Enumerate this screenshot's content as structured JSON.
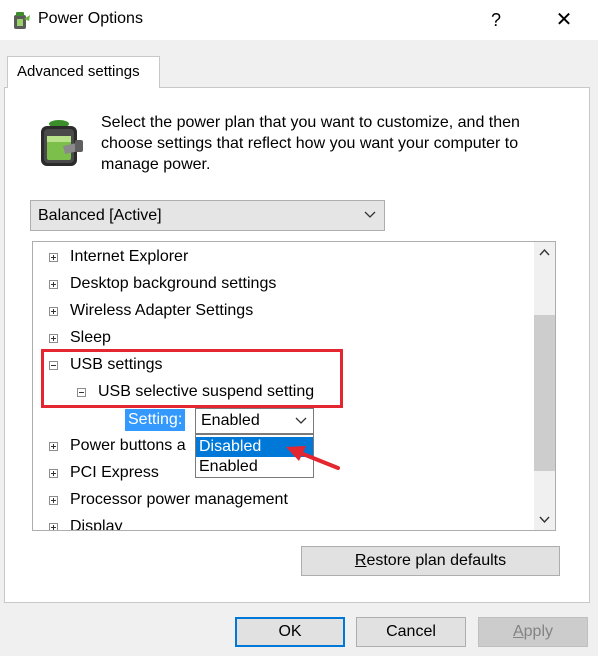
{
  "window": {
    "title": "Power Options",
    "help_label": "?",
    "close_label": "✕"
  },
  "tab": {
    "label": "Advanced settings"
  },
  "description": "Select the power plan that you want to customize, and then choose settings that reflect how you want your computer to manage power.",
  "plan_select": {
    "value": "Balanced [Active]"
  },
  "tree": {
    "items": [
      {
        "label": "Internet Explorer",
        "expanded": false
      },
      {
        "label": "Desktop background settings",
        "expanded": false
      },
      {
        "label": "Wireless Adapter Settings",
        "expanded": false
      },
      {
        "label": "Sleep",
        "expanded": false
      },
      {
        "label": "USB settings",
        "expanded": true
      },
      {
        "label": "USB selective suspend setting",
        "expanded": true
      },
      {
        "label": "Power buttons a",
        "expanded": false
      },
      {
        "label": "PCI Express",
        "expanded": false
      },
      {
        "label": "Processor power management",
        "expanded": false
      },
      {
        "label": "Display",
        "expanded": false
      }
    ]
  },
  "setting": {
    "label": "Setting:",
    "value": "Enabled",
    "options": [
      "Disabled",
      "Enabled"
    ],
    "highlighted_option": "Disabled"
  },
  "buttons": {
    "restore_prefix": "R",
    "restore_rest": "estore plan defaults",
    "ok": "OK",
    "cancel": "Cancel",
    "apply_prefix": "A",
    "apply_rest": "pply"
  },
  "colors": {
    "annotation_red": "#e3262f",
    "selection_blue": "#0078d7",
    "setting_label_blue": "#3399ff"
  }
}
